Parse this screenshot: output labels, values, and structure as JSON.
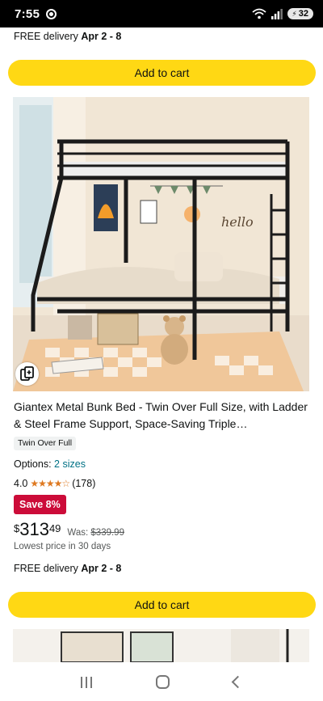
{
  "status": {
    "time": "7:55",
    "battery": "32"
  },
  "top_delivery": {
    "prefix": "FREE delivery",
    "dates": "Apr 2 - 8"
  },
  "buttons": {
    "add_to_cart": "Add to cart"
  },
  "product": {
    "title": "Giantex Metal Bunk Bed - Twin Over Full Size, with Ladder & Steel Frame Support, Space-Saving Triple…",
    "size_chip": "Twin Over Full",
    "options_label": "Options:",
    "options_link": "2 sizes",
    "rating_value": "4.0",
    "rating_stars": "★★★★☆",
    "rating_count": "(178)",
    "save_badge": "Save 8%",
    "price_symbol": "$",
    "price_whole": "313",
    "price_fraction": "49",
    "was_label": "Was:",
    "was_price": "$339.99",
    "lowest_note": "Lowest price in 30 days",
    "delivery_prefix": "FREE delivery",
    "delivery_dates": "Apr 2 - 8"
  },
  "icons": {
    "status_settings": "gear-icon",
    "wifi": "wifi-icon",
    "signal": "signal-icon",
    "compare": "compare-icon",
    "nav_recents": "recents-icon",
    "nav_home": "home-icon",
    "nav_back": "back-icon"
  },
  "colors": {
    "cart_button": "#ffd814",
    "save_badge": "#cc0c39",
    "link": "#007185",
    "stars": "#de7921"
  }
}
